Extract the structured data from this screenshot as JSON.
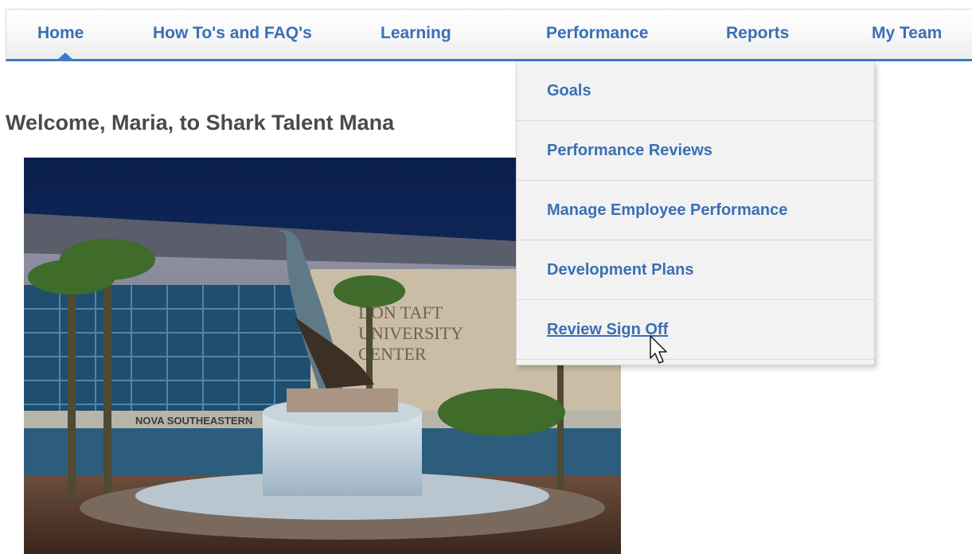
{
  "nav": {
    "items": [
      {
        "label": "Home",
        "active": true
      },
      {
        "label": "How To's and FAQ's"
      },
      {
        "label": "Learning"
      },
      {
        "label": "Performance",
        "open": true
      },
      {
        "label": "Reports"
      },
      {
        "label": "My Team"
      }
    ]
  },
  "welcome": {
    "text": "Welcome, Maria, to Shark Talent Mana"
  },
  "dropdown": {
    "items": [
      {
        "label": "Goals"
      },
      {
        "label": "Performance Reviews"
      },
      {
        "label": "Manage Employee Performance"
      },
      {
        "label": "Development Plans"
      },
      {
        "label": "Review Sign Off",
        "hovered": true
      }
    ]
  },
  "photo": {
    "sign_line1": "DON TAFT",
    "sign_line2": "UNIVERSITY",
    "sign_line3": "CENTER",
    "band_text": "NOVA SOUTHEASTERN"
  },
  "colors": {
    "link": "#3a6fb5",
    "nav_underline": "#3d79c9",
    "heading": "#4a4a4a"
  }
}
